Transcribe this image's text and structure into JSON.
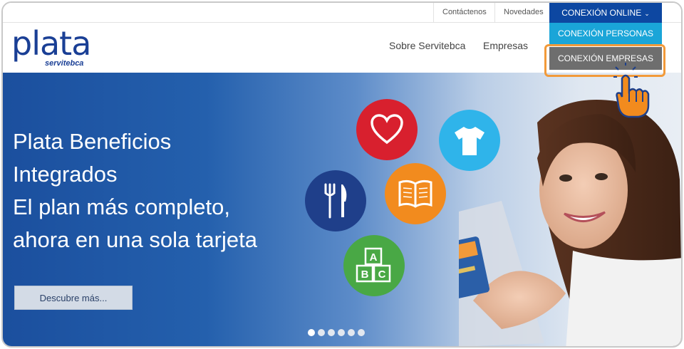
{
  "topbar": {
    "contact_label": "Contáctenos",
    "news_label": "Novedades",
    "conexion_label": "CONEXIÓN ONLINE"
  },
  "logo": {
    "main": "plata",
    "sub": "servitebca"
  },
  "nav": {
    "about": "Sobre Servitebca",
    "companies": "Empresas"
  },
  "dropdown": {
    "personas": "CONEXIÓN PERSONAS",
    "empresas": "CONEXIÓN EMPRESAS"
  },
  "hero": {
    "line1": "Plata Beneficios",
    "line2": "Integrados",
    "line3": "El plan más completo,",
    "line4": "ahora en una sola tarjeta",
    "cta_label": "Descubre más..."
  },
  "icons": [
    "heart-icon",
    "tshirt-icon",
    "fork-knife-icon",
    "book-icon",
    "abc-blocks-icon"
  ],
  "slider": {
    "count": 6,
    "active_index": 0
  },
  "colors": {
    "brand_blue": "#0d47a1",
    "dropdown_light": "#1aa5d8",
    "dropdown_selected": "#6e6e6e",
    "highlight": "#f29a3a",
    "heart": "#d8202e",
    "shirt": "#2fb4ea",
    "fork": "#1f3f8a",
    "book": "#f28b1e",
    "abc": "#49a845"
  }
}
